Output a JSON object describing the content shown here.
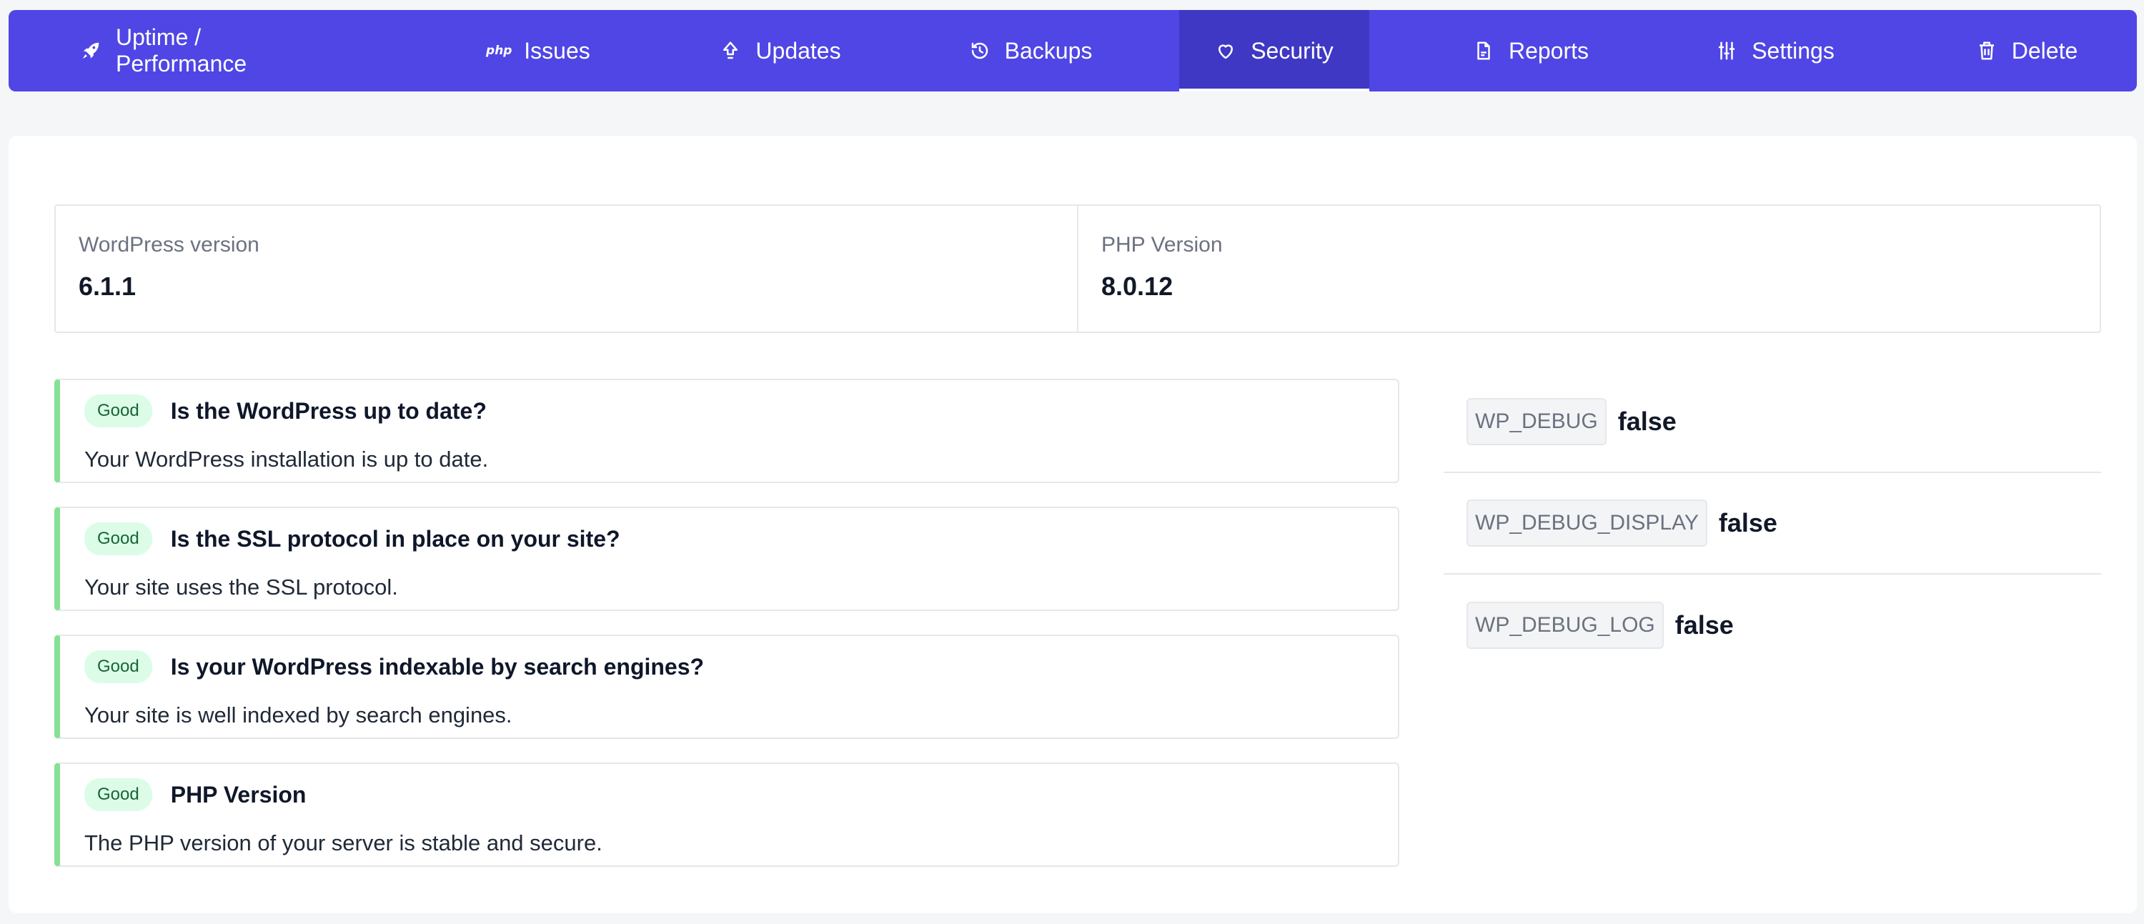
{
  "nav": {
    "items": [
      {
        "label": "Uptime / Performance",
        "icon": "rocket-icon"
      },
      {
        "label": "Issues",
        "icon": "php-icon",
        "glyph": "php"
      },
      {
        "label": "Updates",
        "icon": "arrow-up-icon"
      },
      {
        "label": "Backups",
        "icon": "history-icon"
      },
      {
        "label": "Security",
        "icon": "heart-icon",
        "active": true
      },
      {
        "label": "Reports",
        "icon": "document-icon"
      },
      {
        "label": "Settings",
        "icon": "sliders-icon"
      },
      {
        "label": "Delete",
        "icon": "trash-icon"
      }
    ],
    "bg_color": "#4f46e5",
    "active_color": "#3f38c4"
  },
  "stats": [
    {
      "label": "WordPress version",
      "value": "6.1.1"
    },
    {
      "label": "PHP Version",
      "value": "8.0.12"
    }
  ],
  "checks": [
    {
      "status": "Good",
      "title": "Is the WordPress up to date?",
      "description": "Your WordPress installation is up to date."
    },
    {
      "status": "Good",
      "title": "Is the SSL protocol in place on your site?",
      "description": "Your site uses the SSL protocol."
    },
    {
      "status": "Good",
      "title": "Is your WordPress indexable by search engines?",
      "description": "Your site is well indexed by search engines."
    },
    {
      "status": "Good",
      "title": "PHP Version",
      "description": "The PHP version of your server is stable and secure."
    }
  ],
  "debug": [
    {
      "key": "WP_DEBUG",
      "value": "false"
    },
    {
      "key": "WP_DEBUG_DISPLAY",
      "value": "false"
    },
    {
      "key": "WP_DEBUG_LOG",
      "value": "false"
    }
  ],
  "colors": {
    "good_border": "#86e095",
    "good_badge_bg": "#dcfce7",
    "good_badge_text": "#166534"
  }
}
